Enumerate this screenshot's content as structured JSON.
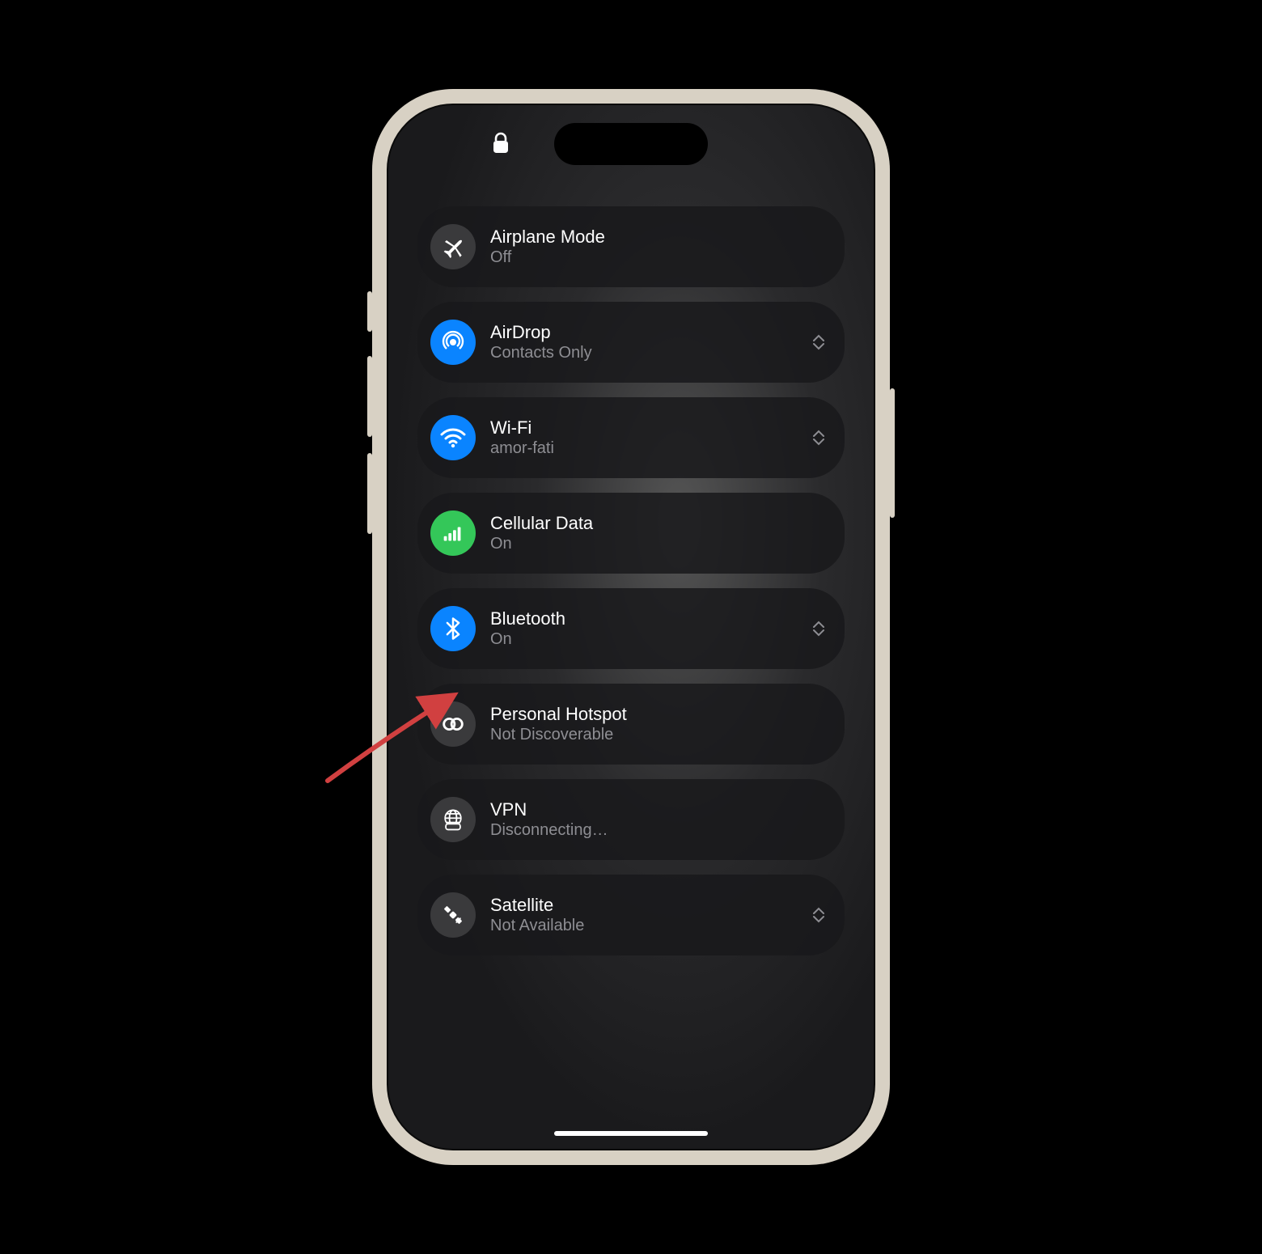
{
  "controls": {
    "airplane": {
      "title": "Airplane Mode",
      "sub": "Off",
      "icon": "airplane",
      "bg": "dark",
      "expand": false
    },
    "airdrop": {
      "title": "AirDrop",
      "sub": "Contacts Only",
      "icon": "airdrop",
      "bg": "blue",
      "expand": true
    },
    "wifi": {
      "title": "Wi-Fi",
      "sub": "amor-fati",
      "icon": "wifi",
      "bg": "blue",
      "expand": true
    },
    "cellular": {
      "title": "Cellular Data",
      "sub": "On",
      "icon": "cellular",
      "bg": "green",
      "expand": false
    },
    "bluetooth": {
      "title": "Bluetooth",
      "sub": "On",
      "icon": "bluetooth",
      "bg": "blue",
      "expand": true
    },
    "hotspot": {
      "title": "Personal Hotspot",
      "sub": "Not Discoverable",
      "icon": "hotspot",
      "bg": "dark",
      "expand": false
    },
    "vpn": {
      "title": "VPN",
      "sub": "Disconnecting…",
      "icon": "vpn",
      "bg": "dark",
      "expand": false
    },
    "satellite": {
      "title": "Satellite",
      "sub": "Not Available",
      "icon": "satellite",
      "bg": "dark",
      "expand": true
    }
  },
  "annotation": {
    "target": "hotspot"
  }
}
